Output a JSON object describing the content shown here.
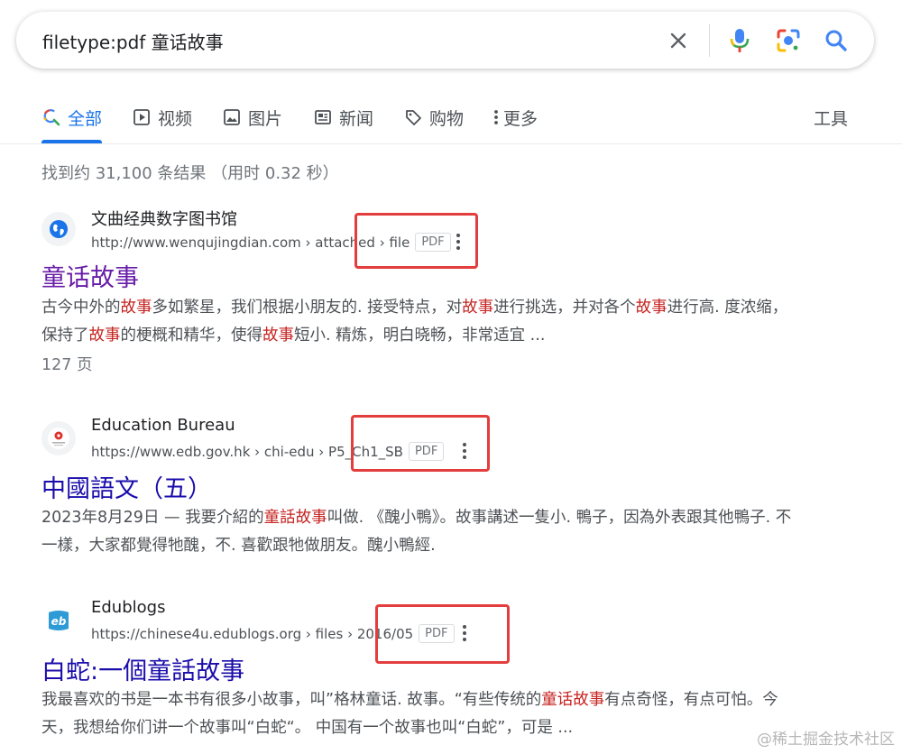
{
  "search": {
    "query": "filetype:pdf 童话故事",
    "clear_icon": "close-icon",
    "voice_icon": "microphone-icon",
    "lens_icon": "camera-lens-icon",
    "search_icon": "search-icon"
  },
  "tabs": [
    {
      "label": "全部",
      "icon": "search-icon",
      "active": true
    },
    {
      "label": "视频",
      "icon": "play-icon"
    },
    {
      "label": "图片",
      "icon": "image-icon"
    },
    {
      "label": "新闻",
      "icon": "news-icon"
    },
    {
      "label": "购物",
      "icon": "tag-icon"
    },
    {
      "label": "更多",
      "icon": "more-vert-icon"
    }
  ],
  "tools_label": "工具",
  "result_stats": "找到约 31,100 条结果 （用时 0.32 秒）",
  "results": [
    {
      "site": "文曲经典数字图书馆",
      "url": "http://www.wenqujingdian.com › attached › file",
      "badge": "PDF",
      "title": "童话故事",
      "snippet_parts": [
        "古今中外的",
        "故事",
        "多如繁星，我们根据小朋友的. 接受特点，对",
        "故事",
        "进行挑选，并对各个",
        "故事",
        "进行高. 度浓缩，保持了",
        "故事",
        "的梗概和精华，使得",
        "故事",
        "短小. 精炼，明白晓畅，非常适宜 ..."
      ],
      "meta": "127 页"
    },
    {
      "site": "Education Bureau",
      "url": "https://www.edb.gov.hk › chi-edu › P5_Ch1_SB",
      "badge": "PDF",
      "title": "中國語文（五）",
      "snippet_parts": [
        "2023年8月29日 — 我要介紹的",
        "童話故事",
        "叫做. 《醜小鴨》。故事講述一隻小. 鴨子，因為外表跟其他鴨子. 不一樣，大家都覺得牠醜，不. 喜歡跟牠做朋友。醜小鴨經."
      ]
    },
    {
      "site": "Edublogs",
      "url": "https://chinese4u.edublogs.org › files › 2016/05",
      "badge": "PDF",
      "title": "白蛇:一個童話故事",
      "snippet_parts": [
        "我最喜欢的书是一本书有很多小故事，叫”格林童话. 故事。“有些传统的",
        "童话故事",
        "有点奇怪，有点可怕。今天，我想给你们讲一个故事叫“白蛇“。 中国有一个故事也叫“白蛇”，可是 ..."
      ]
    }
  ],
  "watermark": "@稀土掘金技术社区",
  "colors": {
    "accent": "#1a73e8",
    "link": "#1a0dab",
    "visited": "#681da8",
    "highlight": "#c5221f",
    "annotation_box": "#e33d3d"
  }
}
